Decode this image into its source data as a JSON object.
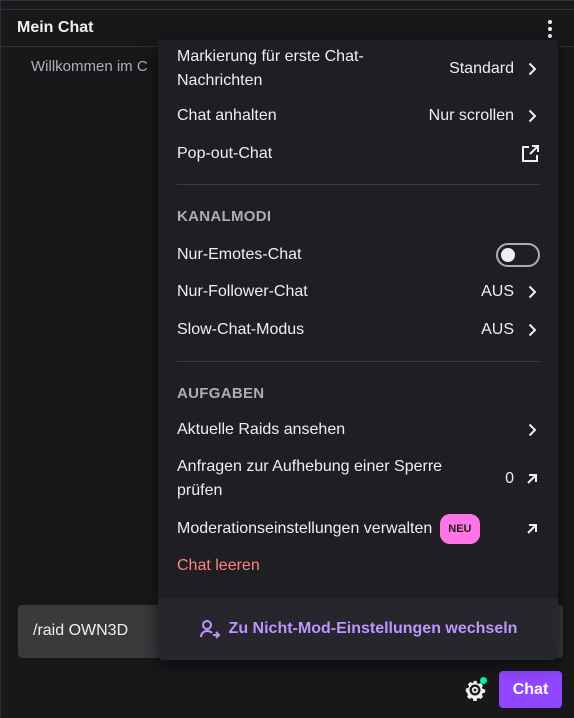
{
  "header": {
    "title": "Mein Chat"
  },
  "chat": {
    "welcome": "Willkommen im C"
  },
  "input": {
    "value": "/raid OWN3D"
  },
  "bottom": {
    "chat_button": "Chat"
  },
  "menu": {
    "highlight": {
      "label": "Markierung für erste Chat-Nachrichten",
      "value": "Standard"
    },
    "pause": {
      "label": "Chat anhalten",
      "value": "Nur scrollen"
    },
    "popout": {
      "label": "Pop-out-Chat"
    },
    "channel_modes_title": "KANALMODI",
    "emotes_only": {
      "label": "Nur-Emotes-Chat",
      "enabled": false
    },
    "followers_only": {
      "label": "Nur-Follower-Chat",
      "value": "AUS"
    },
    "slow_mode": {
      "label": "Slow-Chat-Modus",
      "value": "AUS"
    },
    "tasks_title": "AUFGABEN",
    "raids": {
      "label": "Aktuelle Raids ansehen"
    },
    "unban": {
      "label": "Anfragen zur Aufhebung einer Sperre prüfen",
      "value": "0"
    },
    "mod_settings": {
      "label": "Moderationseinstellungen verwalten",
      "badge": "NEU"
    },
    "clear_chat": {
      "label": "Chat leeren"
    },
    "footer": {
      "label": "Zu Nicht-Mod-Einstellungen wechseln"
    }
  },
  "colors": {
    "accent": "#9147ff",
    "accent_text": "#bf94ff",
    "danger": "#ff8280",
    "badge": "#ff75e6",
    "online": "#00f593"
  }
}
